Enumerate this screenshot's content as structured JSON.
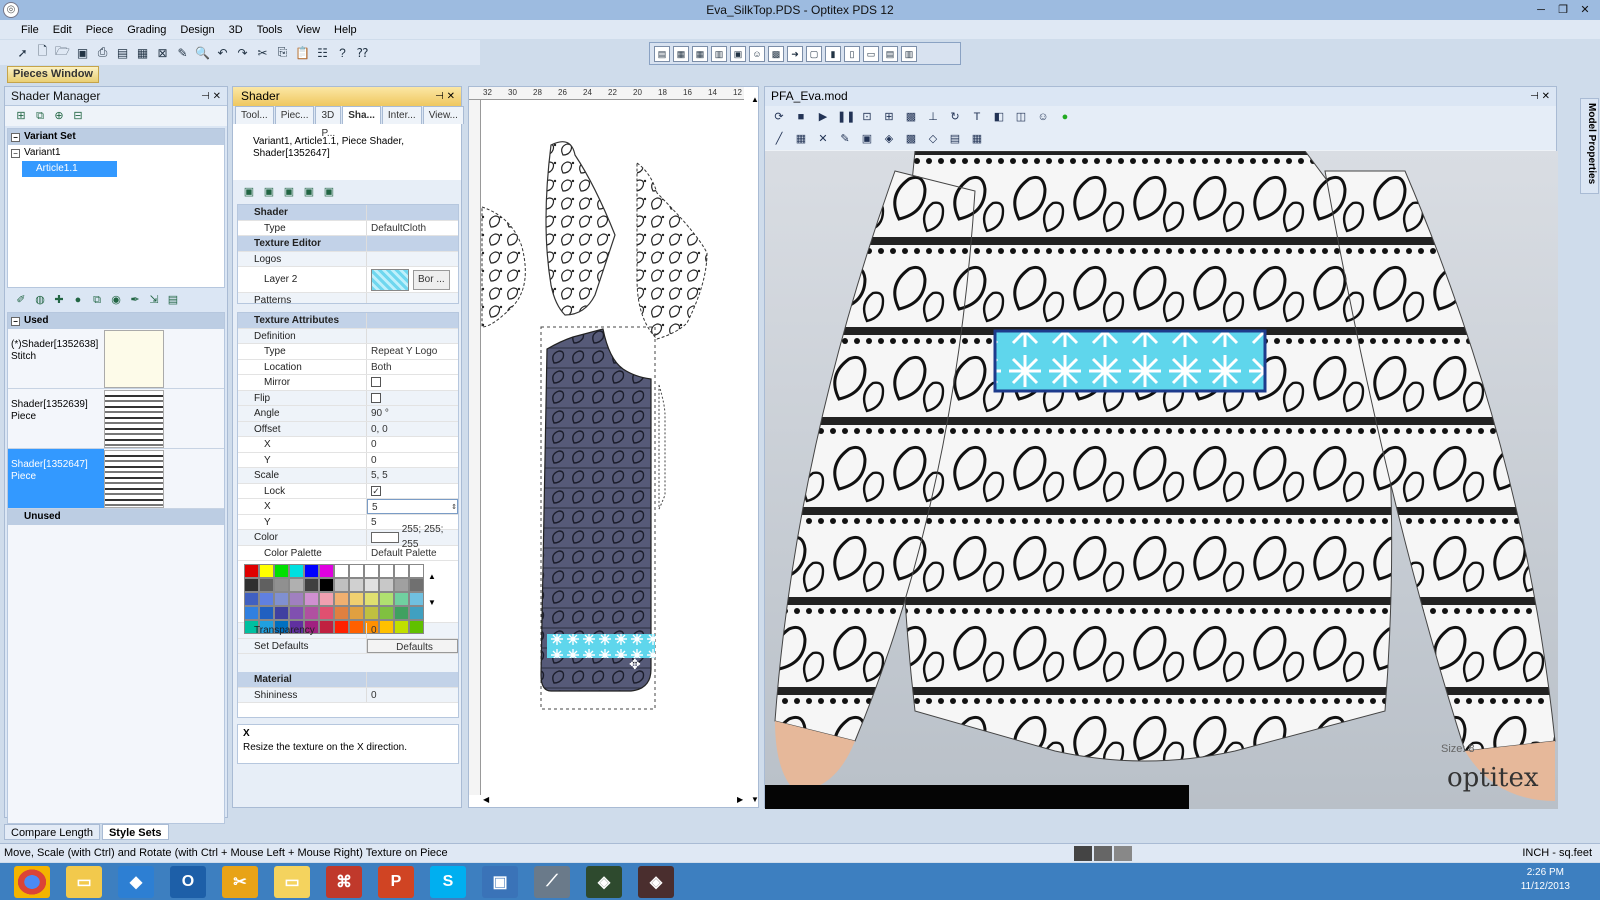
{
  "window": {
    "title": "Eva_SilkTop.PDS - Optitex PDS 12"
  },
  "menu": [
    "File",
    "Edit",
    "Piece",
    "Grading",
    "Design",
    "3D",
    "Tools",
    "View",
    "Help"
  ],
  "pieces_window_label": "Pieces Window",
  "shader_manager": {
    "title": "Shader Manager",
    "variant_set_label": "Variant Set",
    "variant_label": "Variant1",
    "article_label": "Article1.1",
    "used_label": "Used",
    "unused_label": "Unused",
    "shaders": [
      {
        "name": "(*)Shader[1352638]",
        "kind": "Stitch"
      },
      {
        "name": "Shader[1352639]",
        "kind": "Piece"
      },
      {
        "name": "Shader[1352647]",
        "kind": "Piece"
      }
    ]
  },
  "shader_panel": {
    "title": "Shader",
    "tabs": [
      "Tool...",
      "Piec...",
      "3D P...",
      "Sha...",
      "Inter...",
      "View..."
    ],
    "info": "Variant1, Article1.1, Piece Shader, Shader[1352647]",
    "properties": {
      "cat_shader": "Shader",
      "type_label": "Type",
      "type_value": "DefaultCloth",
      "cat_texture_editor": "Texture Editor",
      "logos_label": "Logos",
      "layer_label": "Layer 2",
      "layer_btn": "Bor ...",
      "patterns_label": "Patterns",
      "cat_texture_attr": "Texture Attributes",
      "definition_label": "Definition",
      "def_type_label": "Type",
      "def_type_value": "Repeat Y Logo",
      "location_label": "Location",
      "location_value": "Both",
      "mirror_label": "Mirror",
      "flip_label": "Flip",
      "angle_label": "Angle",
      "angle_value": "90 °",
      "offset_label": "Offset",
      "offset_value": "0, 0",
      "x_label": "X",
      "offset_x": "0",
      "y_label": "Y",
      "offset_y": "0",
      "scale_label": "Scale",
      "scale_value": "5, 5",
      "lock_label": "Lock",
      "scale_x": "5",
      "scale_y": "5",
      "color_label": "Color",
      "color_value": "255; 255; 255",
      "palette_label": "Color Palette",
      "palette_value": "Default Palette",
      "transparency_label": "Transparency",
      "transparency_value": "0",
      "set_defaults_label": "Set Defaults",
      "defaults_btn": "Defaults",
      "cat_material": "Material",
      "shininess_label": "Shininess",
      "shininess_value": "0"
    },
    "help_title": "X",
    "help_text": "Resize the texture on the X direction."
  },
  "ruler": {
    "ticks": [
      "32",
      "30",
      "28",
      "26",
      "24",
      "22",
      "20",
      "18",
      "16",
      "14",
      "12"
    ]
  },
  "view3d": {
    "title": "PFA_Eva.mod",
    "size_label": "Size: 8",
    "logo": "optitex"
  },
  "side_tab": "Model Properties",
  "bottom_tabs": [
    "Compare Length",
    "Style Sets"
  ],
  "statusbar": {
    "text": "Move, Scale (with Ctrl) and Rotate (with Ctrl + Mouse Left + Mouse Right) Texture on Piece",
    "units": "INCH - sq.feet"
  },
  "taskbar": {
    "time": "2:26 PM",
    "date": "11/12/2013"
  },
  "colors": {
    "palette": [
      "#e00000",
      "#ffff00",
      "#00e000",
      "#00e0e0",
      "#0000ff",
      "#e000e0",
      "#ffffff",
      "#ffffff",
      "#ffffff",
      "#ffffff",
      "#ffffff",
      "#ffffff",
      "#303030",
      "#606060",
      "#909090",
      "#b0b0b0",
      "#404040",
      "#000000",
      "#c0c0c0",
      "#d0d0d0",
      "#e0e0e0",
      "#c8c8c8",
      "#a0a0a0",
      "#707070",
      "#4060c0",
      "#6080e0",
      "#8090d0",
      "#a080c0",
      "#d090d0",
      "#f0a0b0",
      "#f0b070",
      "#f0d070",
      "#e0e070",
      "#b0e070",
      "#70d0a0",
      "#70c0e0",
      "#3080e0",
      "#2060c0",
      "#4040a0",
      "#8050b0",
      "#b050a0",
      "#e05070",
      "#e08040",
      "#e0a040",
      "#c0c040",
      "#80c040",
      "#40a060",
      "#40a0c0",
      "#00c0a0",
      "#20a0e0",
      "#0070c0",
      "#6030a0",
      "#a02080",
      "#c02040",
      "#ff2000",
      "#ff6000",
      "#ff9000",
      "#ffc000",
      "#c0e000",
      "#60c000"
    ],
    "accent": "#3399ff",
    "cyan_stripe": "#5fd6ec"
  }
}
